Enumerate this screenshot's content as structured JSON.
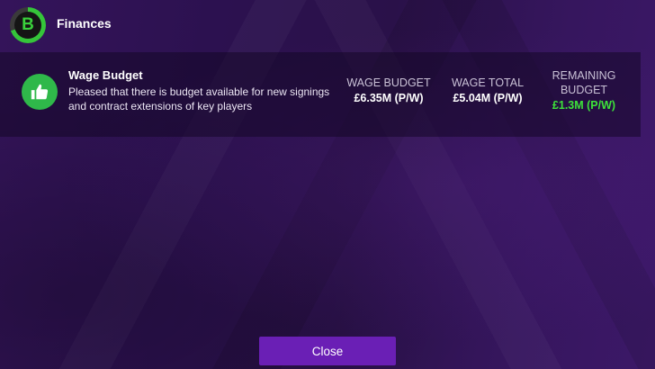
{
  "header": {
    "grade": "B",
    "title": "Finances"
  },
  "wage_section": {
    "title": "Wage Budget",
    "description": "Pleased that there is budget available for new signings and contract extensions of key players",
    "icon": "thumbs-up-icon",
    "stats": [
      {
        "label": "WAGE BUDGET",
        "value": "£6.35M (P/W)"
      },
      {
        "label": "WAGE TOTAL",
        "value": "£5.04M (P/W)"
      },
      {
        "label_line1": "REMAINING",
        "label_line2": "BUDGET",
        "value": "£1.3M (P/W)"
      }
    ]
  },
  "close_button": {
    "label": "Close"
  },
  "colors": {
    "accent_green": "#3de23a",
    "button_purple": "#6a1fb5",
    "thumb_green": "#2fb84a"
  }
}
